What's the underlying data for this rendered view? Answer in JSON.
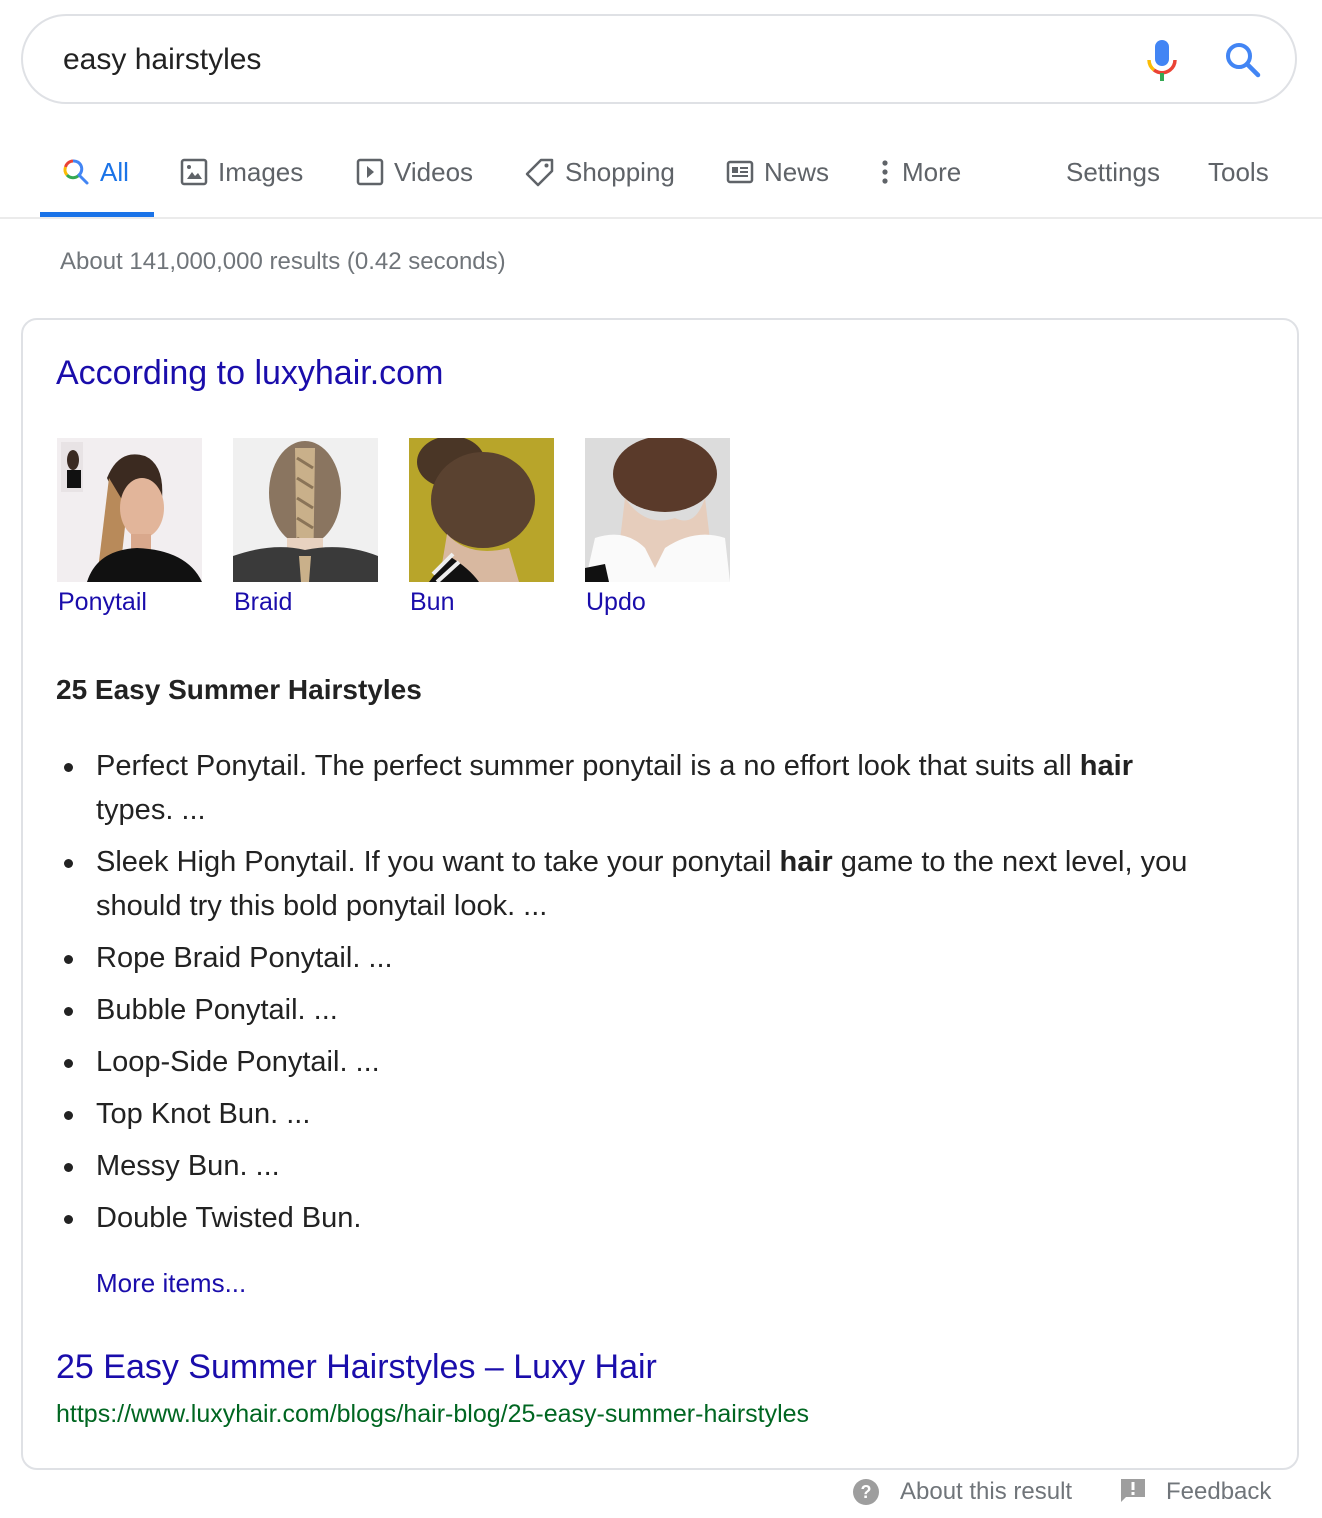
{
  "search": {
    "query": "easy hairstyles",
    "mic_icon": "microphone-icon",
    "search_icon": "search-icon"
  },
  "tabs": [
    {
      "label": "All",
      "icon": "search-multicolor-icon",
      "active": true
    },
    {
      "label": "Images",
      "icon": "image-icon"
    },
    {
      "label": "Videos",
      "icon": "play-icon"
    },
    {
      "label": "Shopping",
      "icon": "tag-icon"
    },
    {
      "label": "News",
      "icon": "newspaper-icon"
    },
    {
      "label": "More",
      "icon": "vertical-dots-icon"
    }
  ],
  "tools": {
    "settings": "Settings",
    "tools": "Tools"
  },
  "result_stats": "About 141,000,000 results (0.42 seconds)",
  "featured": {
    "according_to": "According to luxyhair.com",
    "thumbnails": [
      {
        "label": "Ponytail"
      },
      {
        "label": "Braid"
      },
      {
        "label": "Bun"
      },
      {
        "label": "Updo"
      }
    ],
    "snippet_title": "25 Easy Summer Hairstyles",
    "items": [
      {
        "before": "Perfect Ponytail. The perfect summer ponytail is a no effort look that suits all ",
        "bold": "hair",
        "after": " types. ..."
      },
      {
        "before": "Sleek High Ponytail. If you want to take your ponytail ",
        "bold": "hair",
        "after": " game to the next level, you should try this bold ponytail look. ..."
      },
      {
        "before": "Rope Braid Ponytail. ...",
        "bold": "",
        "after": ""
      },
      {
        "before": "Bubble Ponytail. ...",
        "bold": "",
        "after": ""
      },
      {
        "before": "Loop-Side Ponytail. ...",
        "bold": "",
        "after": ""
      },
      {
        "before": "Top Knot Bun. ...",
        "bold": "",
        "after": ""
      },
      {
        "before": "Messy Bun. ...",
        "bold": "",
        "after": ""
      },
      {
        "before": "Double Twisted Bun.",
        "bold": "",
        "after": ""
      }
    ],
    "more_items": "More items...",
    "result_title": "25 Easy Summer Hairstyles – Luxy Hair",
    "result_url": "https://www.luxyhair.com/blogs/hair-blog/25-easy-summer-hairstyles"
  },
  "footer": {
    "about": "About this result",
    "feedback": "Feedback"
  },
  "colors": {
    "link": "#1a0dab",
    "url": "#006621",
    "accent": "#1a73e8",
    "muted": "#70757a"
  }
}
